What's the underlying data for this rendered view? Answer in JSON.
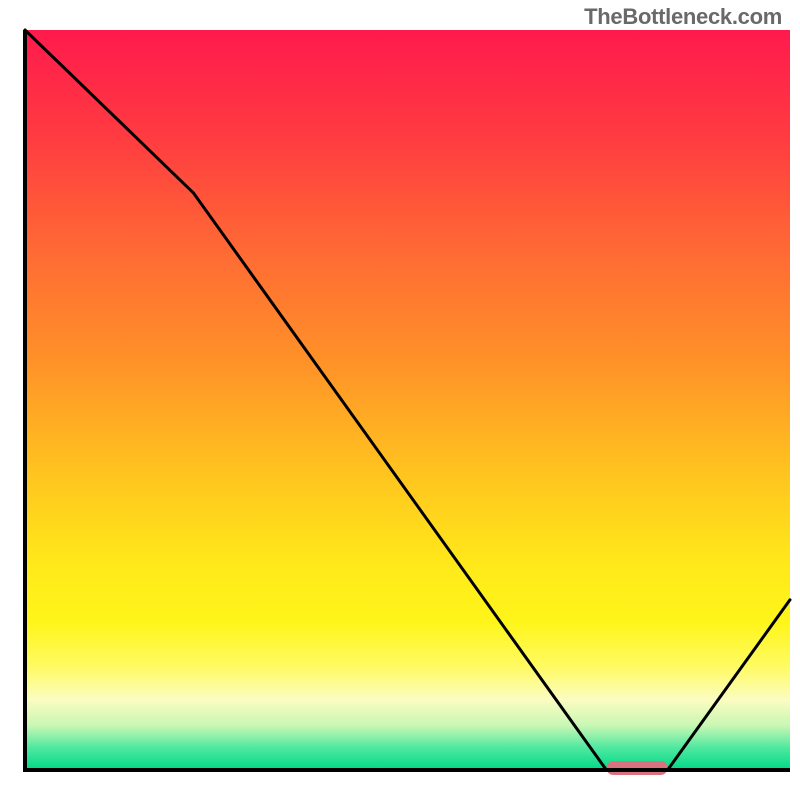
{
  "attribution": "TheBottleneck.com",
  "chart_data": {
    "type": "line",
    "title": "",
    "xlabel": "",
    "ylabel": "",
    "xlim": [
      0,
      100
    ],
    "ylim": [
      0,
      100
    ],
    "x": [
      0,
      22,
      76,
      84,
      100
    ],
    "values": [
      100,
      78,
      0,
      0,
      23
    ],
    "marker": {
      "x_start": 76,
      "x_end": 84,
      "y": 0,
      "color": "#d9727f"
    },
    "gradient_stops": [
      {
        "offset": 0.0,
        "color": "#ff1a4d"
      },
      {
        "offset": 0.14,
        "color": "#ff3a41"
      },
      {
        "offset": 0.3,
        "color": "#ff6a34"
      },
      {
        "offset": 0.45,
        "color": "#ff9228"
      },
      {
        "offset": 0.6,
        "color": "#ffc41f"
      },
      {
        "offset": 0.72,
        "color": "#ffe81a"
      },
      {
        "offset": 0.8,
        "color": "#fff51a"
      },
      {
        "offset": 0.86,
        "color": "#fffb62"
      },
      {
        "offset": 0.905,
        "color": "#fbfcc1"
      },
      {
        "offset": 0.94,
        "color": "#c9f7b4"
      },
      {
        "offset": 0.97,
        "color": "#4fe8a0"
      },
      {
        "offset": 1.0,
        "color": "#00d987"
      }
    ],
    "axis_color": "#000000",
    "line_color": "#000000"
  }
}
